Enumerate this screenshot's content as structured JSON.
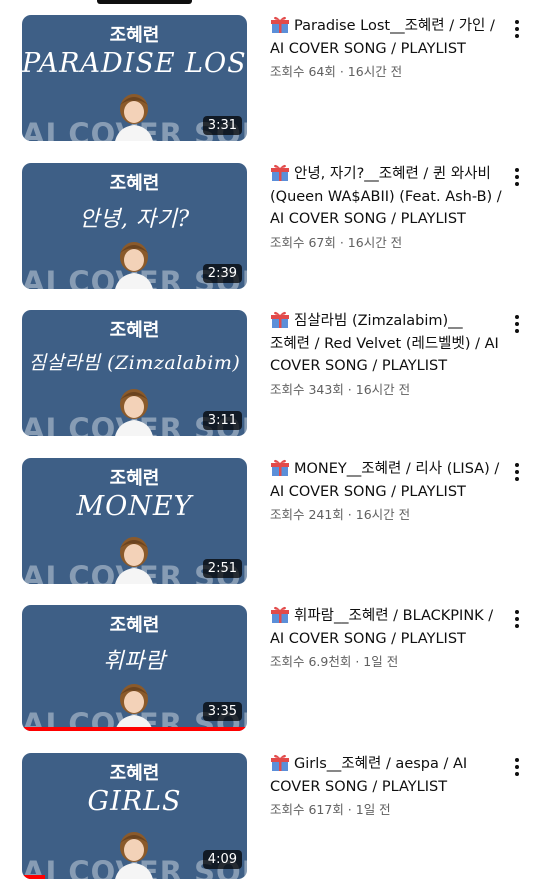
{
  "videos": [
    {
      "thumb_name": "조혜련",
      "thumb_song": "PARADISE LOST",
      "thumb_bg": "AI COVER SONG",
      "duration": "3:31",
      "progress_pct": 0,
      "title": "Paradise Lost__조혜련 / 가인 / AI COVER SONG / PLAYLIST",
      "meta": "조회수 64회 · 16시간 전"
    },
    {
      "thumb_name": "조혜련",
      "thumb_song": "안녕, 자기?",
      "thumb_bg": "AI COVER SONG",
      "duration": "2:39",
      "progress_pct": 0,
      "title": "안녕, 자기?__조혜련 / 퀸 와사비 (Queen WA$ABII) (Feat. Ash-B) / AI COVER SONG / PLAYLIST",
      "meta": "조회수 67회 · 16시간 전"
    },
    {
      "thumb_name": "조혜련",
      "thumb_song": "짐살라빔 (Zimzalabim)",
      "thumb_bg": "AI COVER SONG",
      "duration": "3:11",
      "progress_pct": 0,
      "title": "짐살라빔 (Zimzalabim)__조혜련 / Red Velvet (레드벨벳) / AI COVER SONG / PLAYLIST",
      "meta": "조회수 343회 · 16시간 전"
    },
    {
      "thumb_name": "조혜련",
      "thumb_song": "MONEY",
      "thumb_bg": "AI COVER SONG",
      "duration": "2:51",
      "progress_pct": 0,
      "title": "MONEY__조혜련 / 리사 (LISA) / AI COVER SONG / PLAYLIST",
      "meta": "조회수 241회 · 16시간 전"
    },
    {
      "thumb_name": "조혜련",
      "thumb_song": "휘파람",
      "thumb_bg": "AI COVER SONG",
      "duration": "3:35",
      "progress_pct": 100,
      "title": "휘파람__조혜련 / BLACKPINK / AI COVER SONG / PLAYLIST",
      "meta": "조회수 6.9천회 · 1일 전"
    },
    {
      "thumb_name": "조혜련",
      "thumb_song": "GIRLS",
      "thumb_bg": "AI COVER SONG",
      "duration": "4:09",
      "progress_pct": 10,
      "title": "Girls__조혜련 / aespa / AI COVER SONG / PLAYLIST",
      "meta": "조회수 617회 · 1일 전"
    }
  ],
  "colors": {
    "thumb_bg": "#3e5f86",
    "progress": "#ff0000",
    "meta_text": "#606060"
  },
  "icons": {
    "badge": "gift-icon",
    "menu": "more-vert-icon"
  }
}
